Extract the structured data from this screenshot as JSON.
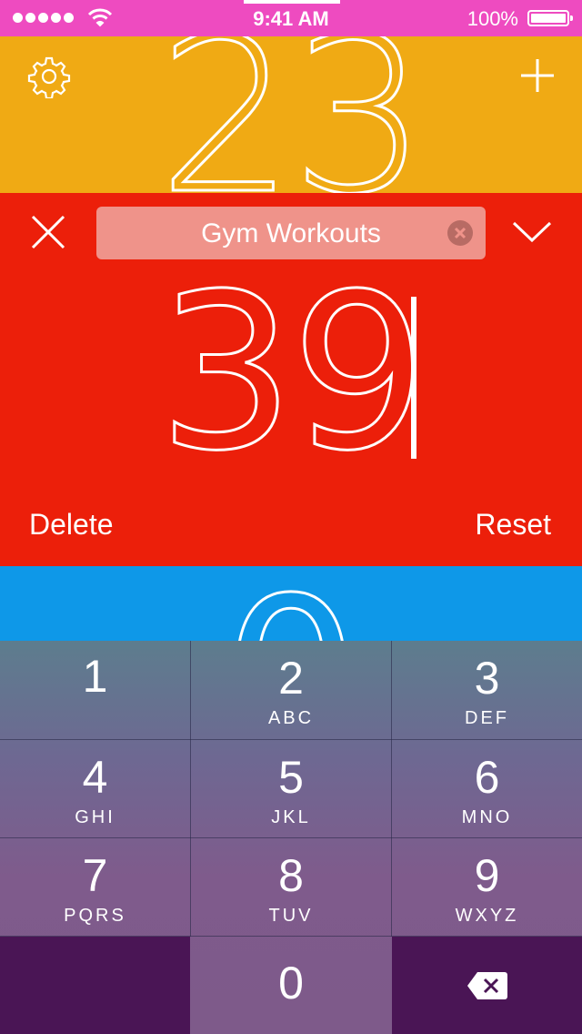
{
  "status": {
    "time": "9:41 AM",
    "battery": "100%",
    "signal_dots": 5
  },
  "counters": {
    "top": {
      "value": "23"
    },
    "editing": {
      "name": "Gym Workouts",
      "value": "39",
      "delete_label": "Delete",
      "reset_label": "Reset"
    },
    "next": {
      "value": "0"
    }
  },
  "keypad": {
    "keys": [
      {
        "num": "1",
        "letters": ""
      },
      {
        "num": "2",
        "letters": "ABC"
      },
      {
        "num": "3",
        "letters": "DEF"
      },
      {
        "num": "4",
        "letters": "GHI"
      },
      {
        "num": "5",
        "letters": "JKL"
      },
      {
        "num": "6",
        "letters": "MNO"
      },
      {
        "num": "7",
        "letters": "PQRS"
      },
      {
        "num": "8",
        "letters": "TUV"
      },
      {
        "num": "9",
        "letters": "WXYZ"
      },
      {
        "num": "0",
        "letters": ""
      }
    ]
  },
  "colors": {
    "status_bar": "#ee4bc0",
    "top_counter": "#f0aa14",
    "edit_counter": "#ec1f0a",
    "next_counter": "#0e98e8"
  },
  "icons": [
    "gear-icon",
    "plus-icon",
    "close-icon",
    "chevron-down-icon",
    "clear-icon",
    "backspace-icon",
    "wifi-icon"
  ]
}
